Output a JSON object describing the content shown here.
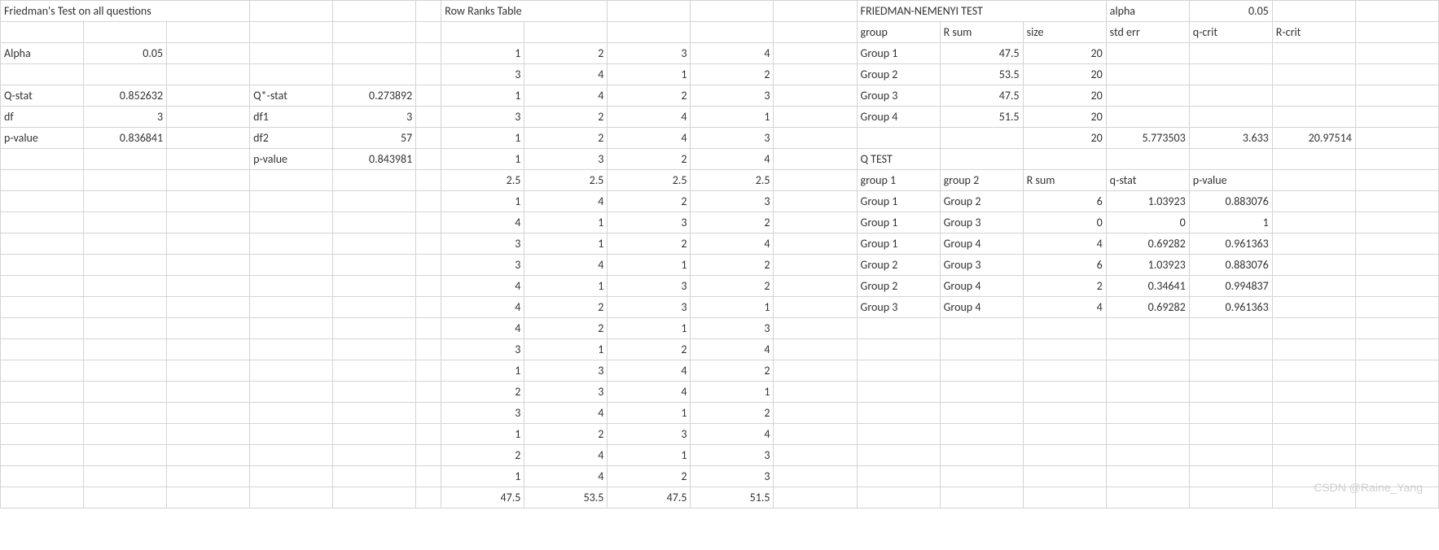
{
  "titles": {
    "friedman": "Friedman's Test on all questions",
    "row_ranks": "Row Ranks Table",
    "nemenyi": "FRIEDMAN-NEMENYI TEST",
    "qtest": "Q TEST"
  },
  "friedman": {
    "alpha_label": "Alpha",
    "alpha": 0.05,
    "qstat_label": "Q-stat",
    "qstat": 0.852632,
    "df_label": "df",
    "df": 3,
    "pvalue_label": "p-value",
    "pvalue": 0.836841,
    "qstar_label": "Q*-stat",
    "qstar": 0.273892,
    "df1_label": "df1",
    "df1": 3,
    "df2_label": "df2",
    "df2": 57,
    "pvalue2_label": "p-value",
    "pvalue2": 0.843981
  },
  "ranks": {
    "rows": [
      [
        1,
        2,
        3,
        4
      ],
      [
        3,
        4,
        1,
        2
      ],
      [
        1,
        4,
        2,
        3
      ],
      [
        3,
        2,
        4,
        1
      ],
      [
        1,
        2,
        4,
        3
      ],
      [
        1,
        3,
        2,
        4
      ],
      [
        2.5,
        2.5,
        2.5,
        2.5
      ],
      [
        1,
        4,
        2,
        3
      ],
      [
        4,
        1,
        3,
        2
      ],
      [
        3,
        1,
        2,
        4
      ],
      [
        3,
        4,
        1,
        2
      ],
      [
        4,
        1,
        3,
        2
      ],
      [
        4,
        2,
        3,
        1
      ],
      [
        4,
        2,
        1,
        3
      ],
      [
        3,
        1,
        2,
        4
      ],
      [
        1,
        3,
        4,
        2
      ],
      [
        2,
        3,
        4,
        1
      ],
      [
        3,
        4,
        1,
        2
      ],
      [
        1,
        2,
        3,
        4
      ],
      [
        2,
        4,
        1,
        3
      ],
      [
        1,
        4,
        2,
        3
      ]
    ],
    "sums": [
      47.5,
      53.5,
      47.5,
      51.5
    ]
  },
  "nemenyi": {
    "alpha_label": "alpha",
    "alpha": 0.05,
    "headers": {
      "group": "group",
      "rsum": "R sum",
      "size": "size",
      "stderr": "std err",
      "qcrit": "q-crit",
      "rcrit": "R-crit"
    },
    "groups": [
      {
        "name": "Group 1",
        "rsum": 47.5,
        "size": 20
      },
      {
        "name": "Group 2",
        "rsum": 53.5,
        "size": 20
      },
      {
        "name": "Group 3",
        "rsum": 47.5,
        "size": 20
      },
      {
        "name": "Group 4",
        "rsum": 51.5,
        "size": 20
      }
    ],
    "summary": {
      "size": 20,
      "stderr": 5.773503,
      "qcrit": 3.633,
      "rcrit": 20.97514
    }
  },
  "qtest": {
    "headers": {
      "g1": "group 1",
      "g2": "group 2",
      "rsum": "R sum",
      "qstat": "q-stat",
      "pvalue": "p-value"
    },
    "rows": [
      {
        "g1": "Group 1",
        "g2": "Group 2",
        "rsum": 6,
        "qstat": 1.03923,
        "pvalue": 0.883076
      },
      {
        "g1": "Group 1",
        "g2": "Group 3",
        "rsum": 0,
        "qstat": 0,
        "pvalue": 1
      },
      {
        "g1": "Group 1",
        "g2": "Group 4",
        "rsum": 4,
        "qstat": 0.69282,
        "pvalue": 0.961363
      },
      {
        "g1": "Group 2",
        "g2": "Group 3",
        "rsum": 6,
        "qstat": 1.03923,
        "pvalue": 0.883076
      },
      {
        "g1": "Group 2",
        "g2": "Group 4",
        "rsum": 2,
        "qstat": 0.34641,
        "pvalue": 0.994837
      },
      {
        "g1": "Group 3",
        "g2": "Group 4",
        "rsum": 4,
        "qstat": 0.69282,
        "pvalue": 0.961363
      }
    ]
  },
  "watermark": "CSDN @Raine_Yang"
}
